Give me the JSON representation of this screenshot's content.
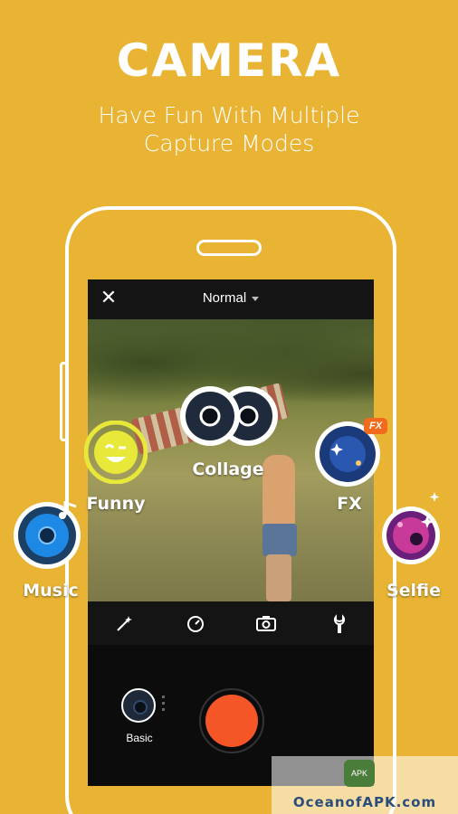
{
  "header": {
    "title": "CAMERA",
    "subtitle_line1": "Have Fun With Multiple",
    "subtitle_line2": "Capture Modes"
  },
  "app": {
    "mode_selector": "Normal",
    "basic_label": "Basic",
    "accent_color": "#f45628",
    "background_color": "#e9b334"
  },
  "toolbar_icons": [
    "magic-wand-icon",
    "timer-icon",
    "camera-switch-icon",
    "wrench-icon"
  ],
  "modes": {
    "collage": "Collage",
    "funny": "Funny",
    "fx": "FX",
    "fx_badge": "FX",
    "music": "Music",
    "selfie": "Selfie"
  },
  "watermark": {
    "logo_text": "APK",
    "text": "OceanofAPK.com"
  }
}
